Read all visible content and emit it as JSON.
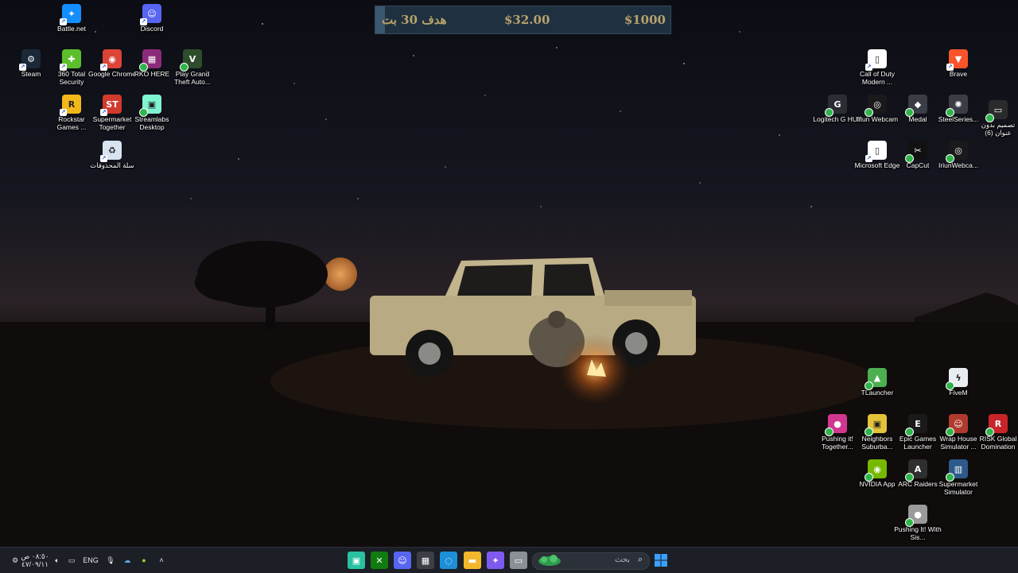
{
  "goal_widget": {
    "goal_label": "هدف 30 بت",
    "current_amount": "$32.00",
    "target_amount": "$1000",
    "progress_fraction": 0.032
  },
  "desktop_left": [
    {
      "label": "Battle.net",
      "icon": "battlenet-icon",
      "color": "#148eff",
      "glyph": "✦"
    },
    {
      "label": "Discord",
      "icon": "discord-icon",
      "color": "#5865f2",
      "glyph": "☺"
    },
    {
      "label": "Steam",
      "icon": "steam-icon",
      "color": "#1b2838",
      "glyph": "⚙"
    },
    {
      "label": "360 Total Security",
      "icon": "shield-icon",
      "color": "#5bbf2b",
      "glyph": "✚"
    },
    {
      "label": "Google Chrome",
      "icon": "chrome-icon",
      "color": "#db4437",
      "glyph": "◉"
    },
    {
      "label": "RKO HERE",
      "icon": "rko-archive-icon",
      "color": "#8c2a7a",
      "glyph": "▦"
    },
    {
      "label": "Play Grand Theft Auto...",
      "icon": "gta-icon",
      "color": "#2e4d2c",
      "glyph": "V"
    },
    {
      "label": "Rockstar Games ...",
      "icon": "rockstar-icon",
      "color": "#f3b719",
      "glyph": "R"
    },
    {
      "label": "Supermarket Together",
      "icon": "supermarket-together-icon",
      "color": "#d23a2e",
      "glyph": "ST"
    },
    {
      "label": "Streamlabs Desktop",
      "icon": "streamlabs-icon",
      "color": "#80f5d2",
      "glyph": "▣"
    },
    {
      "label": "سلة المحذوفات",
      "icon": "recycle-bin-icon",
      "color": "#d7e3ee",
      "glyph": "♻"
    }
  ],
  "desktop_right": [
    {
      "label": "Call of Duty Modern ...",
      "icon": "file-icon",
      "color": "#ffffff",
      "glyph": "▯"
    },
    {
      "label": "Brave",
      "icon": "brave-icon",
      "color": "#fb542b",
      "glyph": "▼"
    },
    {
      "label": "Logitech G HUB",
      "icon": "logitech-icon",
      "color": "#2a2d33",
      "glyph": "G"
    },
    {
      "label": "Iriun Webcam",
      "icon": "webcam-icon",
      "color": "#1a1a1a",
      "glyph": "◎"
    },
    {
      "label": "Medal",
      "icon": "medal-icon",
      "color": "#3a3d45",
      "glyph": "◆"
    },
    {
      "label": "SteelSeries...",
      "icon": "steelseries-icon",
      "color": "#3a3d45",
      "glyph": "✺"
    },
    {
      "label": "تصميم بدون عنوان (6)",
      "icon": "design-icon",
      "color": "#2b2b2b",
      "glyph": "▭"
    },
    {
      "label": "Microsoft Edge",
      "icon": "file-icon",
      "color": "#ffffff",
      "glyph": "▯"
    },
    {
      "label": "CapCut",
      "icon": "capcut-icon",
      "color": "#111111",
      "glyph": "✂"
    },
    {
      "label": "IriunWebca...",
      "icon": "webcam-icon",
      "color": "#1a1a1a",
      "glyph": "◎"
    },
    {
      "label": "TLauncher",
      "icon": "tlauncher-icon",
      "color": "#4caf50",
      "glyph": "▲"
    },
    {
      "label": "FiveM",
      "icon": "fivem-icon",
      "color": "#e8edf2",
      "glyph": "ϟ"
    },
    {
      "label": "Pushing it! Together...",
      "icon": "pushing-it-icon",
      "color": "#d2378f",
      "glyph": "●"
    },
    {
      "label": "Neighbors Suburba...",
      "icon": "neighbors-icon",
      "color": "#e4c33a",
      "glyph": "▣"
    },
    {
      "label": "Epic Games Launcher",
      "icon": "epic-games-icon",
      "color": "#1a1a1a",
      "glyph": "E"
    },
    {
      "label": "Wrap House Simulator ...",
      "icon": "wrap-house-icon",
      "color": "#b03a2e",
      "glyph": "☺"
    },
    {
      "label": "RISK Global Domination",
      "icon": "risk-icon",
      "color": "#c8242a",
      "glyph": "R"
    },
    {
      "label": "NVIDIA App",
      "icon": "nvidia-icon",
      "color": "#76b900",
      "glyph": "◉"
    },
    {
      "label": "ARC Raiders",
      "icon": "arc-raiders-icon",
      "color": "#2f2f2f",
      "glyph": "A"
    },
    {
      "label": "Supermarket Simulator",
      "icon": "supermarket-simulator-icon",
      "color": "#2d5a8a",
      "glyph": "▥"
    },
    {
      "label": "Pushing It! With Sis...",
      "icon": "pushing-it-sis-icon",
      "color": "#9a9a9a",
      "glyph": "●"
    }
  ],
  "taskbar": {
    "clock_time": "٠٨:٥٠ ص",
    "clock_date": "٤٧/٠٩/١١",
    "language": "ENG",
    "search_placeholder": "بحث",
    "apps": [
      {
        "icon": "streamlabs-taskbar-icon",
        "color": "#28c2a0",
        "glyph": "▣"
      },
      {
        "icon": "xbox-icon",
        "color": "#107c10",
        "glyph": "✕"
      },
      {
        "icon": "discord-taskbar-icon",
        "color": "#5865f2",
        "glyph": "☺"
      },
      {
        "icon": "store-icon",
        "color": "#3c3f46",
        "glyph": "▦"
      },
      {
        "icon": "edge-icon",
        "color": "#1d8ed8",
        "glyph": "◌"
      },
      {
        "icon": "file-explorer-icon",
        "color": "#f2b72b",
        "glyph": "▬"
      },
      {
        "icon": "copilot-icon",
        "color": "#7f5af0",
        "glyph": "✦"
      },
      {
        "icon": "window-icon",
        "color": "#8b8f96",
        "glyph": "▭"
      }
    ]
  }
}
